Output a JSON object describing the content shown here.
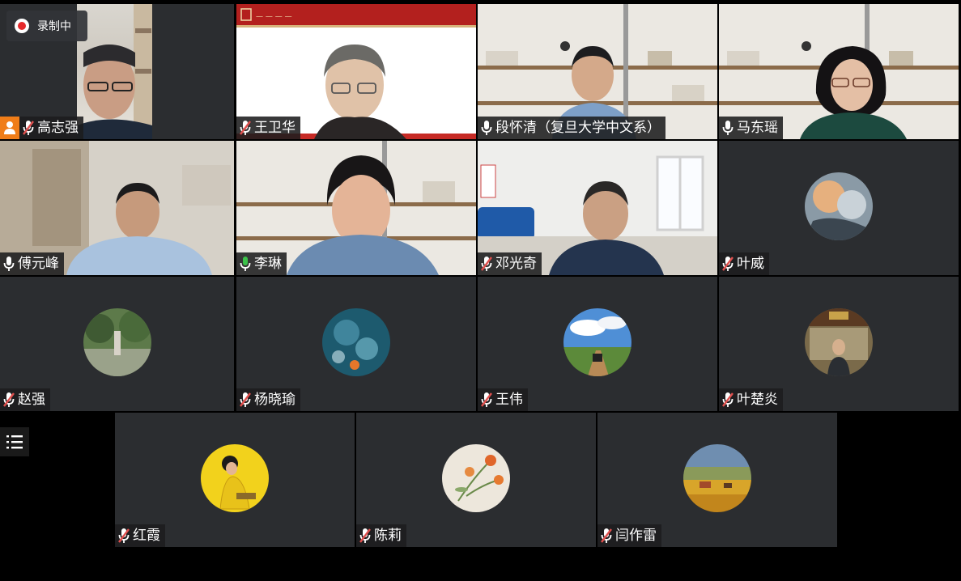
{
  "recording": {
    "label": "录制中"
  },
  "participants": [
    {
      "name": "高志强",
      "mic": "muted"
    },
    {
      "name": "王卫华",
      "mic": "muted"
    },
    {
      "name": "段怀清（复旦大学中文系）",
      "mic": "on"
    },
    {
      "name": "马东瑶",
      "mic": "on"
    },
    {
      "name": "傅元峰",
      "mic": "on"
    },
    {
      "name": "李琳",
      "mic": "speaking"
    },
    {
      "name": "邓光奇",
      "mic": "muted"
    },
    {
      "name": "叶威",
      "mic": "muted"
    },
    {
      "name": "赵强",
      "mic": "muted"
    },
    {
      "name": "杨晓瑜",
      "mic": "muted"
    },
    {
      "name": "王伟",
      "mic": "muted"
    },
    {
      "name": "叶楚炎",
      "mic": "muted"
    },
    {
      "name": "红霞",
      "mic": "muted"
    },
    {
      "name": "陈莉",
      "mic": "muted"
    },
    {
      "name": "闫作雷",
      "mic": "muted"
    }
  ],
  "colors": {
    "tile": "#2b2d30",
    "muted_mic": "#e0504e",
    "speaking_mic": "#3cc24a",
    "rec": "#e5292b",
    "host_badge": "#f07d18"
  },
  "icons": {
    "muted": "mic-muted-icon",
    "on": "mic-icon",
    "speaking": "mic-speaking-icon",
    "list": "participant-list-icon",
    "record": "record-icon",
    "host": "host-person-icon"
  }
}
